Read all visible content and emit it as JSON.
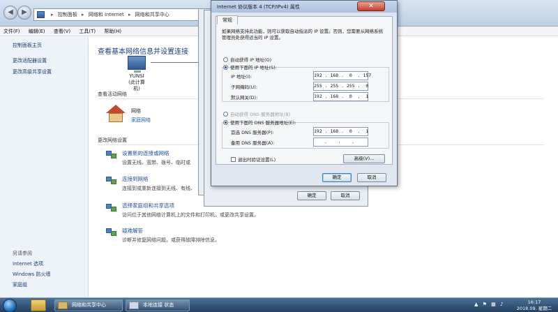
{
  "explorer": {
    "address": {
      "segments": [
        "控制面板",
        "网络和 Internet",
        "网络和共享中心"
      ],
      "separator": "▸"
    },
    "menu": [
      "文件(F)",
      "编辑(E)",
      "查看(V)",
      "工具(T)",
      "帮助(H)"
    ],
    "left_pane": {
      "home": "控制面板主页",
      "items": [
        "更改适配器设置",
        "更改高级共享设置"
      ],
      "see_also_title": "另请参阅",
      "see_also": [
        "Internet 选项",
        "Windows 防火墙",
        "家庭组"
      ]
    },
    "main": {
      "title": "查看基本网络信息并设置连接",
      "computer_name": "YUNSI",
      "computer_sub": "(此计算机)",
      "active_networks_heading": "查看活动网络",
      "network_name": "网络",
      "network_type": "家庭网络",
      "change_settings_heading": "更改网络设置",
      "tasks": [
        {
          "title": "设置新的连接或网络",
          "desc": "设置无线、宽带、拨号、临时或"
        },
        {
          "title": "连接到网络",
          "desc": "连接到或重新连接到无线、有线、"
        },
        {
          "title": "选择家庭组和共享选项",
          "desc": "访问位于其他网络计算机上的文件和打印机，或更改共享设置。"
        },
        {
          "title": "疑难解答",
          "desc": "诊断并修复网络问题，或获得故障排除信息。"
        }
      ]
    }
  },
  "background_dialog": {
    "ok": "确定",
    "cancel": "取消"
  },
  "dialog": {
    "title": "Internet 协议版本 4 (TCP/IPv4) 属性",
    "close": "✕",
    "tab": "常规",
    "description": "如果网络支持此功能，则可以获取自动指派的 IP 设置。否则，您需要从网络系统管理员处获得适当的 IP 设置。",
    "auto_ip_label": "自动获得 IP 地址(O)",
    "manual_ip_label": "使用下面的 IP 地址(S):",
    "ip_label": "IP 地址(I):",
    "ip_value": "192 . 168 .  0  . 157",
    "mask_label": "子网掩码(U):",
    "mask_value": "255 . 255 . 255 .  0",
    "gateway_label": "默认网关(D):",
    "gateway_value": "192 . 168 .  0  .  1",
    "auto_dns_label": "自动获得 DNS 服务器地址(B)",
    "manual_dns_label": "使用下面的 DNS 服务器地址(E):",
    "dns1_label": "首选 DNS 服务器(P):",
    "dns1_value": "192 . 168 .  0  .  1",
    "dns2_label": "备用 DNS 服务器(A):",
    "dns2_value": "  .    .    .   ",
    "validate_label": "退出时验证设置(L)",
    "advanced_button": "高级(V)...",
    "ok": "确定",
    "cancel": "取消"
  },
  "taskbar": {
    "tasks": [
      "网络和共享中心",
      "本地连接 状态"
    ],
    "time": "16:17",
    "date": "2018.09. 星期二"
  }
}
